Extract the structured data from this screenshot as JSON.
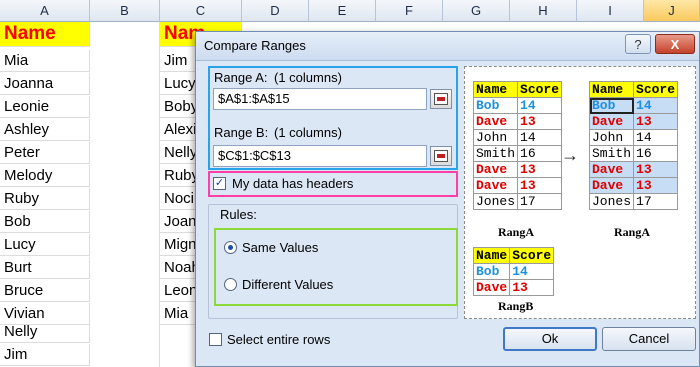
{
  "spreadsheet": {
    "columns": [
      "A",
      "B",
      "C",
      "D",
      "E",
      "F",
      "G",
      "H",
      "I",
      "J"
    ],
    "selected_column": "J",
    "col_a": [
      "Name",
      "Mia",
      "Joanna",
      "Leonie",
      "Ashley",
      "Peter",
      "Melody",
      "Ruby",
      "Bob",
      "Lucy",
      "Burt",
      "Bruce",
      "Vivian",
      "Nelly",
      "Jim"
    ],
    "col_c": [
      "Nam",
      "Jim",
      "Lucy",
      "Boby",
      "Alexi",
      "Nelly",
      "Ruby",
      "Noci",
      "Joan",
      "Mign",
      "Noah",
      "Leon",
      "Mia"
    ]
  },
  "dialog": {
    "title": "Compare Ranges",
    "help_label": "?",
    "close_label": "X",
    "range_a": {
      "label": "Range A:",
      "count": "(1 columns)",
      "value": "$A$1:$A$15"
    },
    "range_b": {
      "label": "Range B:",
      "count": "(1 columns)",
      "value": "$C$1:$C$13"
    },
    "headers_checkbox": {
      "label": "My data has headers",
      "checked": true
    },
    "rules_label": "Rules:",
    "rules": [
      {
        "label": "Same Values",
        "selected": true
      },
      {
        "label": "Different Values",
        "selected": false
      }
    ],
    "select_rows": {
      "label": "Select entire rows",
      "checked": false
    },
    "ok_label": "Ok",
    "cancel_label": "Cancel",
    "accent_colors": {
      "range_box": "#29a3e8",
      "headers_box": "#ff3fa6",
      "rules_box": "#8ed93a"
    }
  },
  "preview": {
    "range_a_before": {
      "header": [
        "Name",
        "Score"
      ],
      "rows": [
        [
          "Bob",
          "14"
        ],
        [
          "Dave",
          "13"
        ],
        [
          "John",
          "14"
        ],
        [
          "Smith",
          "16"
        ],
        [
          "Dave",
          "13"
        ],
        [
          "Dave",
          "13"
        ],
        [
          "Jones",
          "17"
        ]
      ],
      "caption": "RangA"
    },
    "range_b": {
      "header": [
        "Name",
        "Score"
      ],
      "rows": [
        [
          "Bob",
          "14"
        ],
        [
          "Dave",
          "13"
        ]
      ],
      "caption": "RangB"
    },
    "arrow": "→",
    "range_a_after": {
      "header": [
        "Name",
        "Score"
      ],
      "rows": [
        [
          "Bob",
          "14"
        ],
        [
          "Dave",
          "13"
        ],
        [
          "John",
          "14"
        ],
        [
          "Smith",
          "16"
        ],
        [
          "Dave",
          "13"
        ],
        [
          "Dave",
          "13"
        ],
        [
          "Jones",
          "17"
        ]
      ],
      "highlighted": [
        true,
        true,
        false,
        false,
        true,
        true,
        false
      ],
      "caption": "RangA"
    }
  }
}
